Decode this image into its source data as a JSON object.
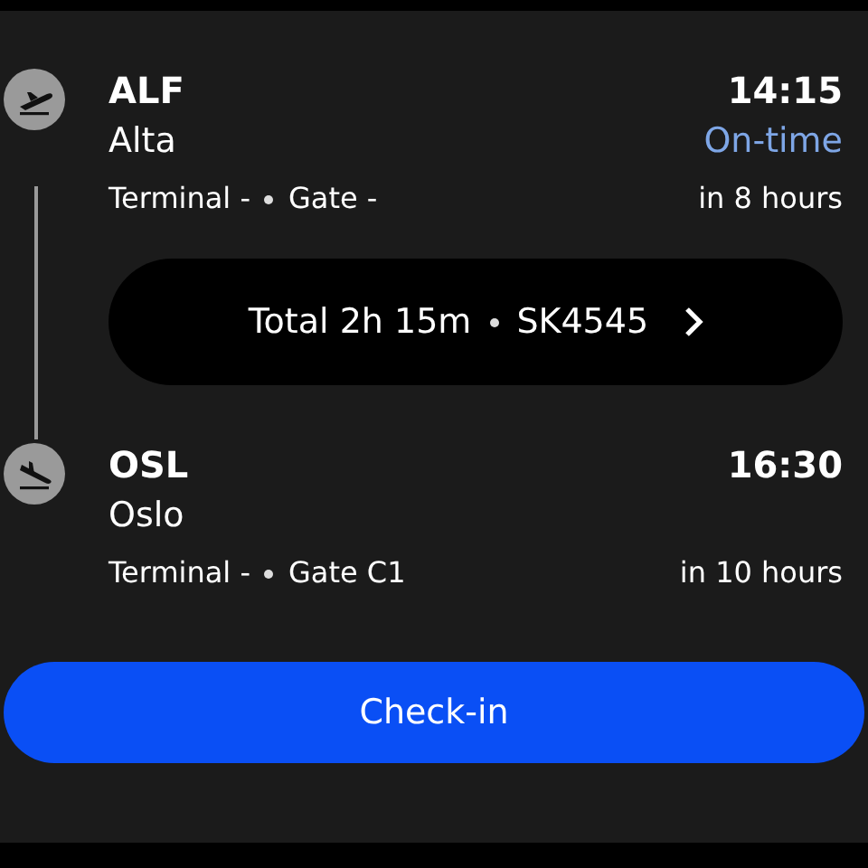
{
  "stops": [
    {
      "kind": "departure",
      "code": "ALF",
      "city": "Alta",
      "time": "14:15",
      "status": "On-time",
      "terminal": "Terminal -",
      "gate": "Gate -",
      "relative": "in 8 hours"
    },
    {
      "kind": "arrival",
      "code": "OSL",
      "city": "Oslo",
      "time": "16:30",
      "terminal": "Terminal -",
      "gate": "Gate C1",
      "relative": "in 10 hours"
    }
  ],
  "flight": {
    "duration": "Total 2h 15m",
    "number": "SK4545"
  },
  "button": {
    "label": "Check-in"
  }
}
